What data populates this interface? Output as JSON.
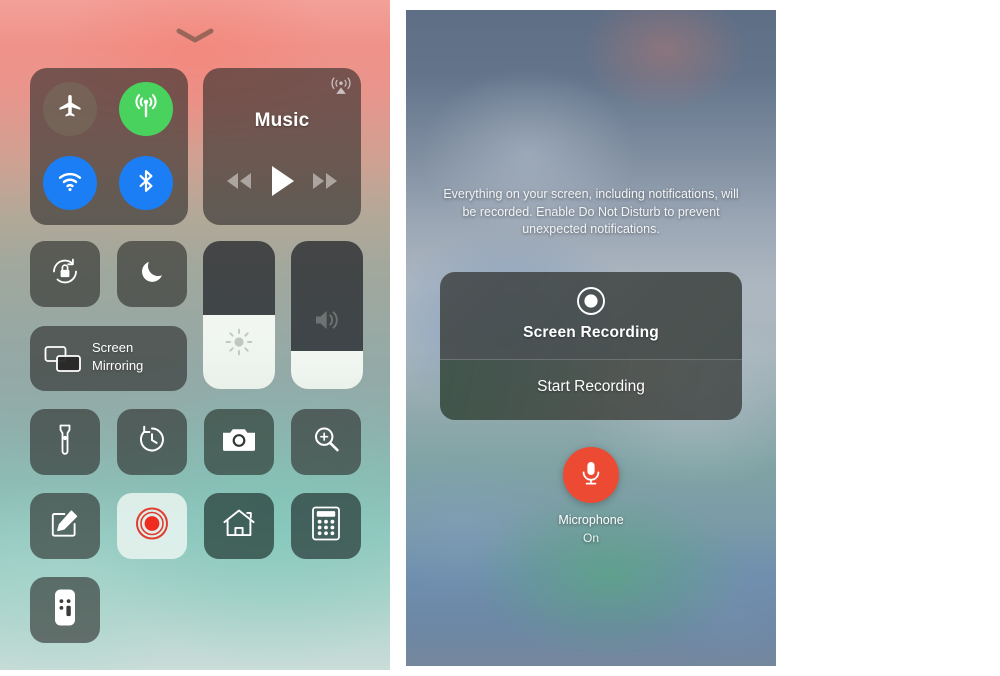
{
  "control_center": {
    "handle_icon": "chevron-down-icon",
    "connectivity": {
      "airplane": {
        "label": "Airplane Mode",
        "icon": "airplane-icon",
        "state": "off",
        "color": "#787059"
      },
      "cellular": {
        "label": "Cellular Data",
        "icon": "cellular-antenna-icon",
        "state": "on",
        "color": "#4ad25e"
      },
      "wifi": {
        "label": "Wi-Fi",
        "icon": "wifi-icon",
        "state": "on",
        "color": "#1b7ef4"
      },
      "bluetooth": {
        "label": "Bluetooth",
        "icon": "bluetooth-icon",
        "state": "on",
        "color": "#1b7ef4"
      }
    },
    "media": {
      "title": "Music",
      "airplay_icon": "airplay-audio-icon",
      "rewind_label": "Rewind",
      "play_label": "Play",
      "forward_label": "Fast Forward"
    },
    "rotation_lock": {
      "label": "Rotation Lock",
      "icon": "rotation-lock-icon",
      "state": "off"
    },
    "do_not_disturb": {
      "label": "Do Not Disturb",
      "icon": "moon-icon",
      "state": "off"
    },
    "screen_mirroring": {
      "line1": "Screen",
      "line2": "Mirroring",
      "icon": "screen-mirroring-icon"
    },
    "brightness": {
      "label": "Brightness",
      "icon": "brightness-sun-icon",
      "value_percent": 50
    },
    "volume": {
      "label": "Volume",
      "icon": "speaker-icon",
      "value_percent": 26
    },
    "shortcuts": [
      {
        "name": "flashlight",
        "label": "Flashlight",
        "icon": "flashlight-icon",
        "active": false
      },
      {
        "name": "timer",
        "label": "Timer",
        "icon": "timer-icon",
        "active": false
      },
      {
        "name": "camera",
        "label": "Camera",
        "icon": "camera-icon",
        "active": false
      },
      {
        "name": "magnifier",
        "label": "Magnifier",
        "icon": "magnifier-icon",
        "active": false
      },
      {
        "name": "notes",
        "label": "Notes",
        "icon": "notes-pencil-icon",
        "active": false
      },
      {
        "name": "screen-recording",
        "label": "Screen Recording",
        "icon": "record-icon",
        "active": true
      },
      {
        "name": "home",
        "label": "Home",
        "icon": "home-icon",
        "active": false
      },
      {
        "name": "calculator",
        "label": "Calculator",
        "icon": "calculator-icon",
        "active": false
      },
      {
        "name": "apple-tv-remote",
        "label": "Apple TV Remote",
        "icon": "remote-icon",
        "active": false
      }
    ]
  },
  "screen_recording_sheet": {
    "description": "Everything on your screen, including notifications, will be recorded. Enable Do Not Disturb to prevent unexpected notifications.",
    "record_icon": "record-icon",
    "title": "Screen Recording",
    "start_label": "Start Recording",
    "microphone": {
      "icon": "microphone-icon",
      "label": "Microphone",
      "state": "On",
      "color": "#ec4a33"
    }
  }
}
